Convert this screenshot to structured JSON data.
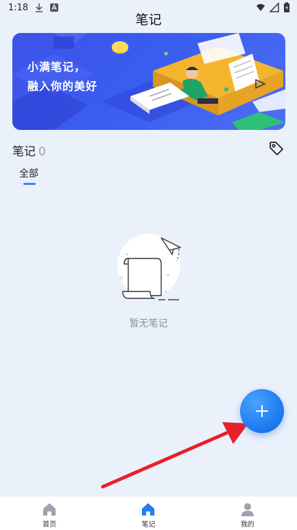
{
  "status": {
    "time": "1:18"
  },
  "header": {
    "title": "笔记"
  },
  "banner": {
    "line1": "小满笔记，",
    "line2": "融入你的美好"
  },
  "notes": {
    "heading": "笔记",
    "count": "0"
  },
  "tabs": [
    {
      "label": "全部",
      "active": true
    }
  ],
  "empty_state": {
    "text": "暂无笔记"
  },
  "bottom_nav": [
    {
      "label": "首页",
      "icon": "home-icon",
      "active": false
    },
    {
      "label": "笔记",
      "icon": "notes-home-icon",
      "active": true
    },
    {
      "label": "我的",
      "icon": "person-icon",
      "active": false
    }
  ],
  "colors": {
    "accent": "#1f7ef0",
    "banner": "#3d53e8",
    "annotation": "#e8202a",
    "background": "#eaf1fa"
  }
}
